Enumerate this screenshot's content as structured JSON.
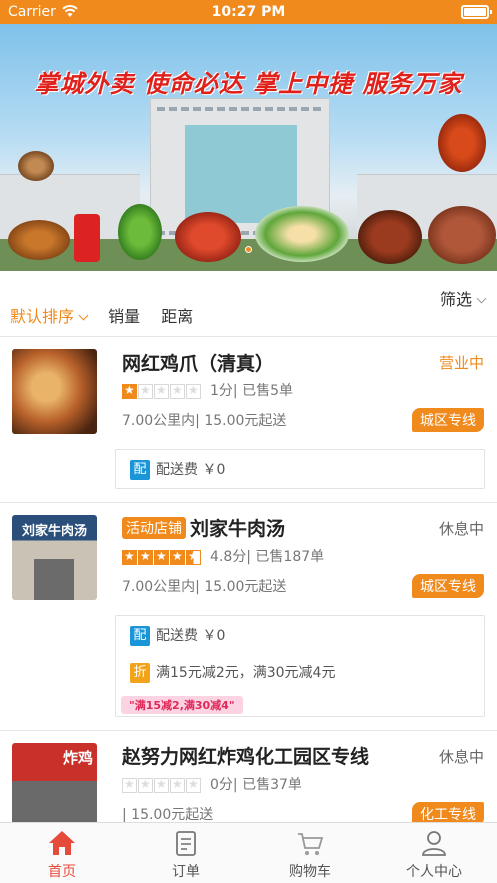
{
  "status_bar": {
    "carrier": "Carrier",
    "time": "10:27 PM"
  },
  "banner": {
    "slogan": "掌城外卖  使命必达  掌上中捷  服务万家",
    "page_count": 3,
    "active_page": 1
  },
  "sort_bar": {
    "filter_label": "筛选",
    "tabs": [
      {
        "label": "默认排序",
        "active": true
      },
      {
        "label": "销量"
      },
      {
        "label": "距离"
      }
    ]
  },
  "stores": [
    {
      "name": "网红鸡爪（清真）",
      "activity_tag": "",
      "status": "营业中",
      "stars_full": 1,
      "stars_half": 0,
      "rating_text": "1分| 已售5单",
      "distance_text": "7.00公里内| 15.00元起送",
      "zone": "城区专线",
      "delivery_badge": "配",
      "delivery_fee": "配送费 ￥0",
      "discount_badge": "",
      "discount_text": "",
      "promo_pill": ""
    },
    {
      "name": "刘家牛肉汤",
      "activity_tag": "活动店铺",
      "status": "休息中",
      "stars_full": 4,
      "stars_half": 1,
      "rating_text": "4.8分| 已售187单",
      "distance_text": "7.00公里内| 15.00元起送",
      "zone": "城区专线",
      "delivery_badge": "配",
      "delivery_fee": "配送费 ￥0",
      "discount_badge": "折",
      "discount_text": "满15元减2元，满30元减4元",
      "promo_pill": "\"满15减2,满30减4\"",
      "thumb_text": "刘家牛肉汤"
    },
    {
      "name": "赵努力网红炸鸡化工园区专线",
      "activity_tag": "",
      "status": "休息中",
      "stars_full": 0,
      "stars_half": 0,
      "rating_text": "0分| 已售37单",
      "distance_text": "| 15.00元起送",
      "zone": "化工专线",
      "thumb_text": "炸鸡"
    }
  ],
  "tab_bar": [
    {
      "label": "首页",
      "icon": "home-icon",
      "active": true
    },
    {
      "label": "订单",
      "icon": "order-icon"
    },
    {
      "label": "购物车",
      "icon": "cart-icon"
    },
    {
      "label": "个人中心",
      "icon": "user-icon"
    }
  ],
  "colors": {
    "accent": "#f08a1c",
    "active_tab": "#e64a3a",
    "delivery_badge": "#1a95d8",
    "discount_badge": "#f2a31a"
  }
}
